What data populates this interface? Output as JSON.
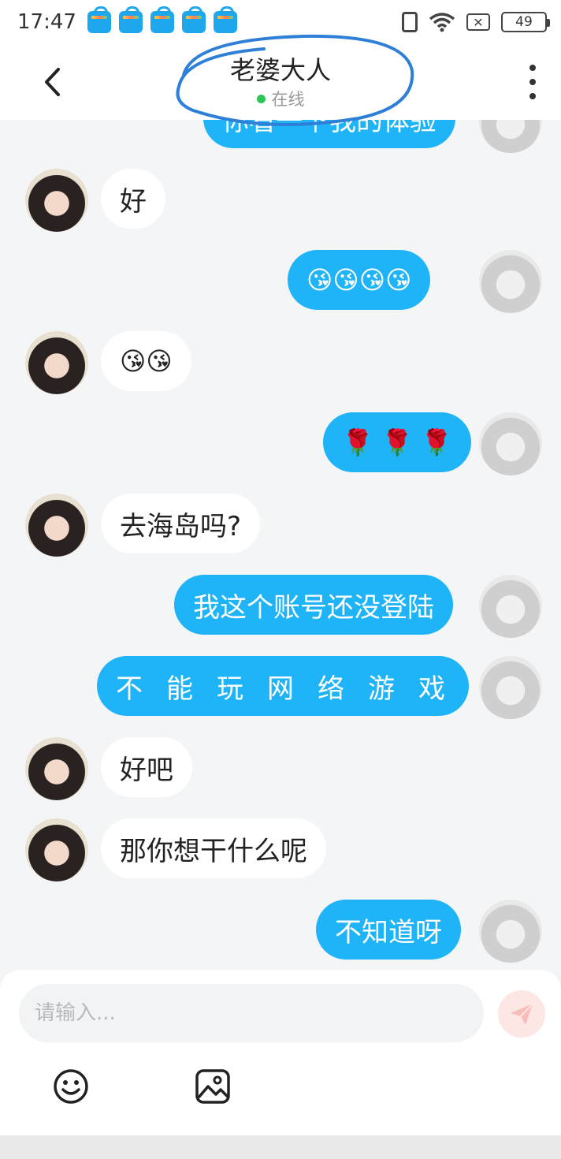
{
  "status_bar": {
    "time": "17:47",
    "battery": "49",
    "notification_icon": "app-bag-icon"
  },
  "header": {
    "title": "老婆大人",
    "online_status": "在线"
  },
  "messages": [
    {
      "side": "right",
      "text": "你看一下我的体验"
    },
    {
      "side": "left",
      "text": "好"
    },
    {
      "side": "right",
      "text": "😘😘😘😘"
    },
    {
      "side": "left",
      "text": "😘😘"
    },
    {
      "side": "right",
      "text": "🌹 🌹 🌹"
    },
    {
      "side": "left",
      "text": "去海岛吗?"
    },
    {
      "side": "right",
      "text": "我这个账号还没登陆"
    },
    {
      "side": "right",
      "text": "不能玩网络游戏"
    },
    {
      "side": "left",
      "text": "好吧"
    },
    {
      "side": "left",
      "text": "那你想干什么呢"
    },
    {
      "side": "right",
      "text": "不知道呀"
    }
  ],
  "input": {
    "placeholder": "请输入..."
  },
  "colors": {
    "bubble_right": "#1fb3f7",
    "bubble_left": "#ffffff",
    "background": "#f3f5f7",
    "online_dot": "#2bc655",
    "send_button": "#fde7e5"
  }
}
